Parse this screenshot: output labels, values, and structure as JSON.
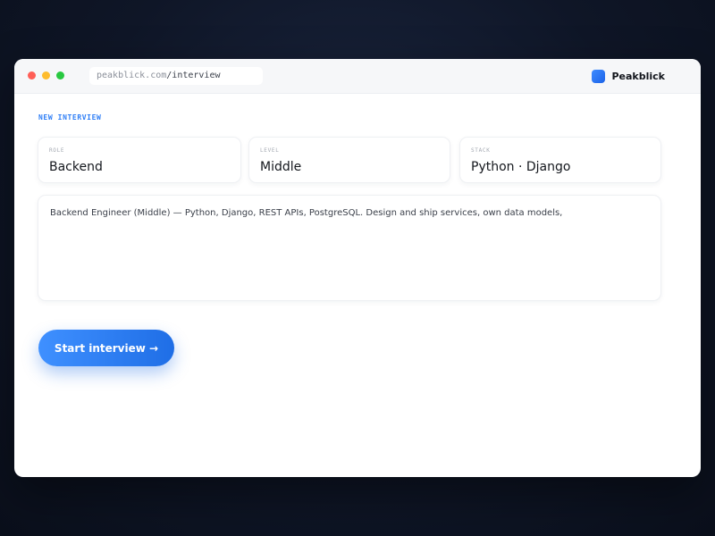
{
  "browser": {
    "url_host": "peakblick.com",
    "url_path": "/interview"
  },
  "brand": {
    "name": "Peakblick",
    "logo_color": "#2d7df6"
  },
  "form": {
    "section_label": "NEW INTERVIEW",
    "role": {
      "label": "ROLE",
      "value": "Backend"
    },
    "level": {
      "label": "LEVEL",
      "value": "Middle"
    },
    "stack": {
      "label": "STACK",
      "value": "Python · Django"
    },
    "description": "Backend Engineer (Middle) — Python, Django, REST APIs, PostgreSQL. Design and ship services, own data models,",
    "start_button": "Start interview →"
  },
  "colors": {
    "accent": "#2d7df6",
    "window_bg": "#ffffff",
    "backdrop": "#0f1627"
  }
}
